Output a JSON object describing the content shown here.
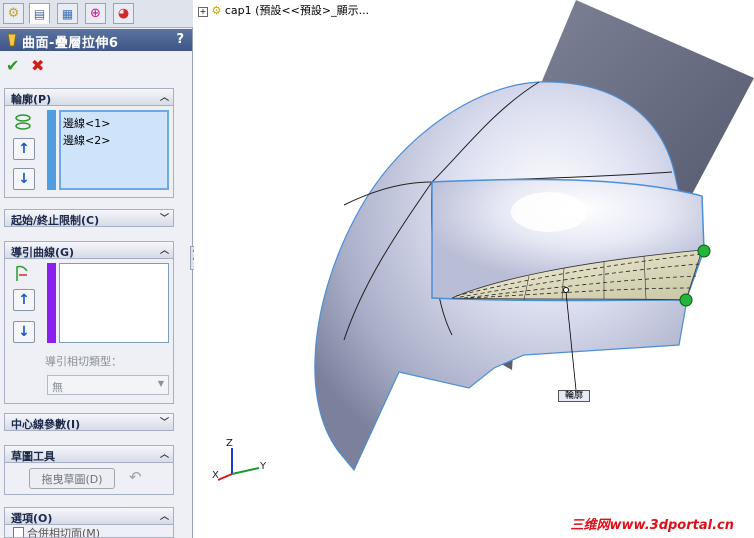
{
  "tabs": [
    {
      "icon": "feature-manager-icon"
    },
    {
      "icon": "property-manager-icon"
    },
    {
      "icon": "configuration-manager-icon"
    },
    {
      "icon": "dimxpert-icon"
    },
    {
      "icon": "display-manager-icon"
    }
  ],
  "header": {
    "title": "曲面-疊層拉伸6",
    "help": "?"
  },
  "actions": {
    "ok": "✔",
    "cancel": "✖"
  },
  "sections": {
    "profile": {
      "title": "輪廓(P)",
      "items": [
        "邊線<1>",
        "邊線<2>"
      ]
    },
    "start_end": {
      "title": "起始/終止限制(C)"
    },
    "guides": {
      "title": "導引曲線(G)",
      "tangency_label": "導引相切類型：",
      "tangency_value": "無"
    },
    "centerline": {
      "title": "中心線參數(I)"
    },
    "sketch_tools": {
      "title": "草圖工具",
      "drag_sketch": "拖曳草圖(D)"
    },
    "options": {
      "title": "選項(O)",
      "partial": "合併相切面(M)"
    }
  },
  "tree": {
    "label": "cap1  (預設<<預設>_顯示..."
  },
  "callout": {
    "label": "輪廓"
  },
  "triad": {
    "x": "X",
    "y": "Y",
    "z": "Z"
  },
  "watermark": {
    "text": "三维网www.3dportal.cn"
  },
  "colors": {
    "accent_blue": "#4f9fe0",
    "guide_purple": "#8b1ff0",
    "header": "#4a6392",
    "watermark": "#e0101a"
  }
}
